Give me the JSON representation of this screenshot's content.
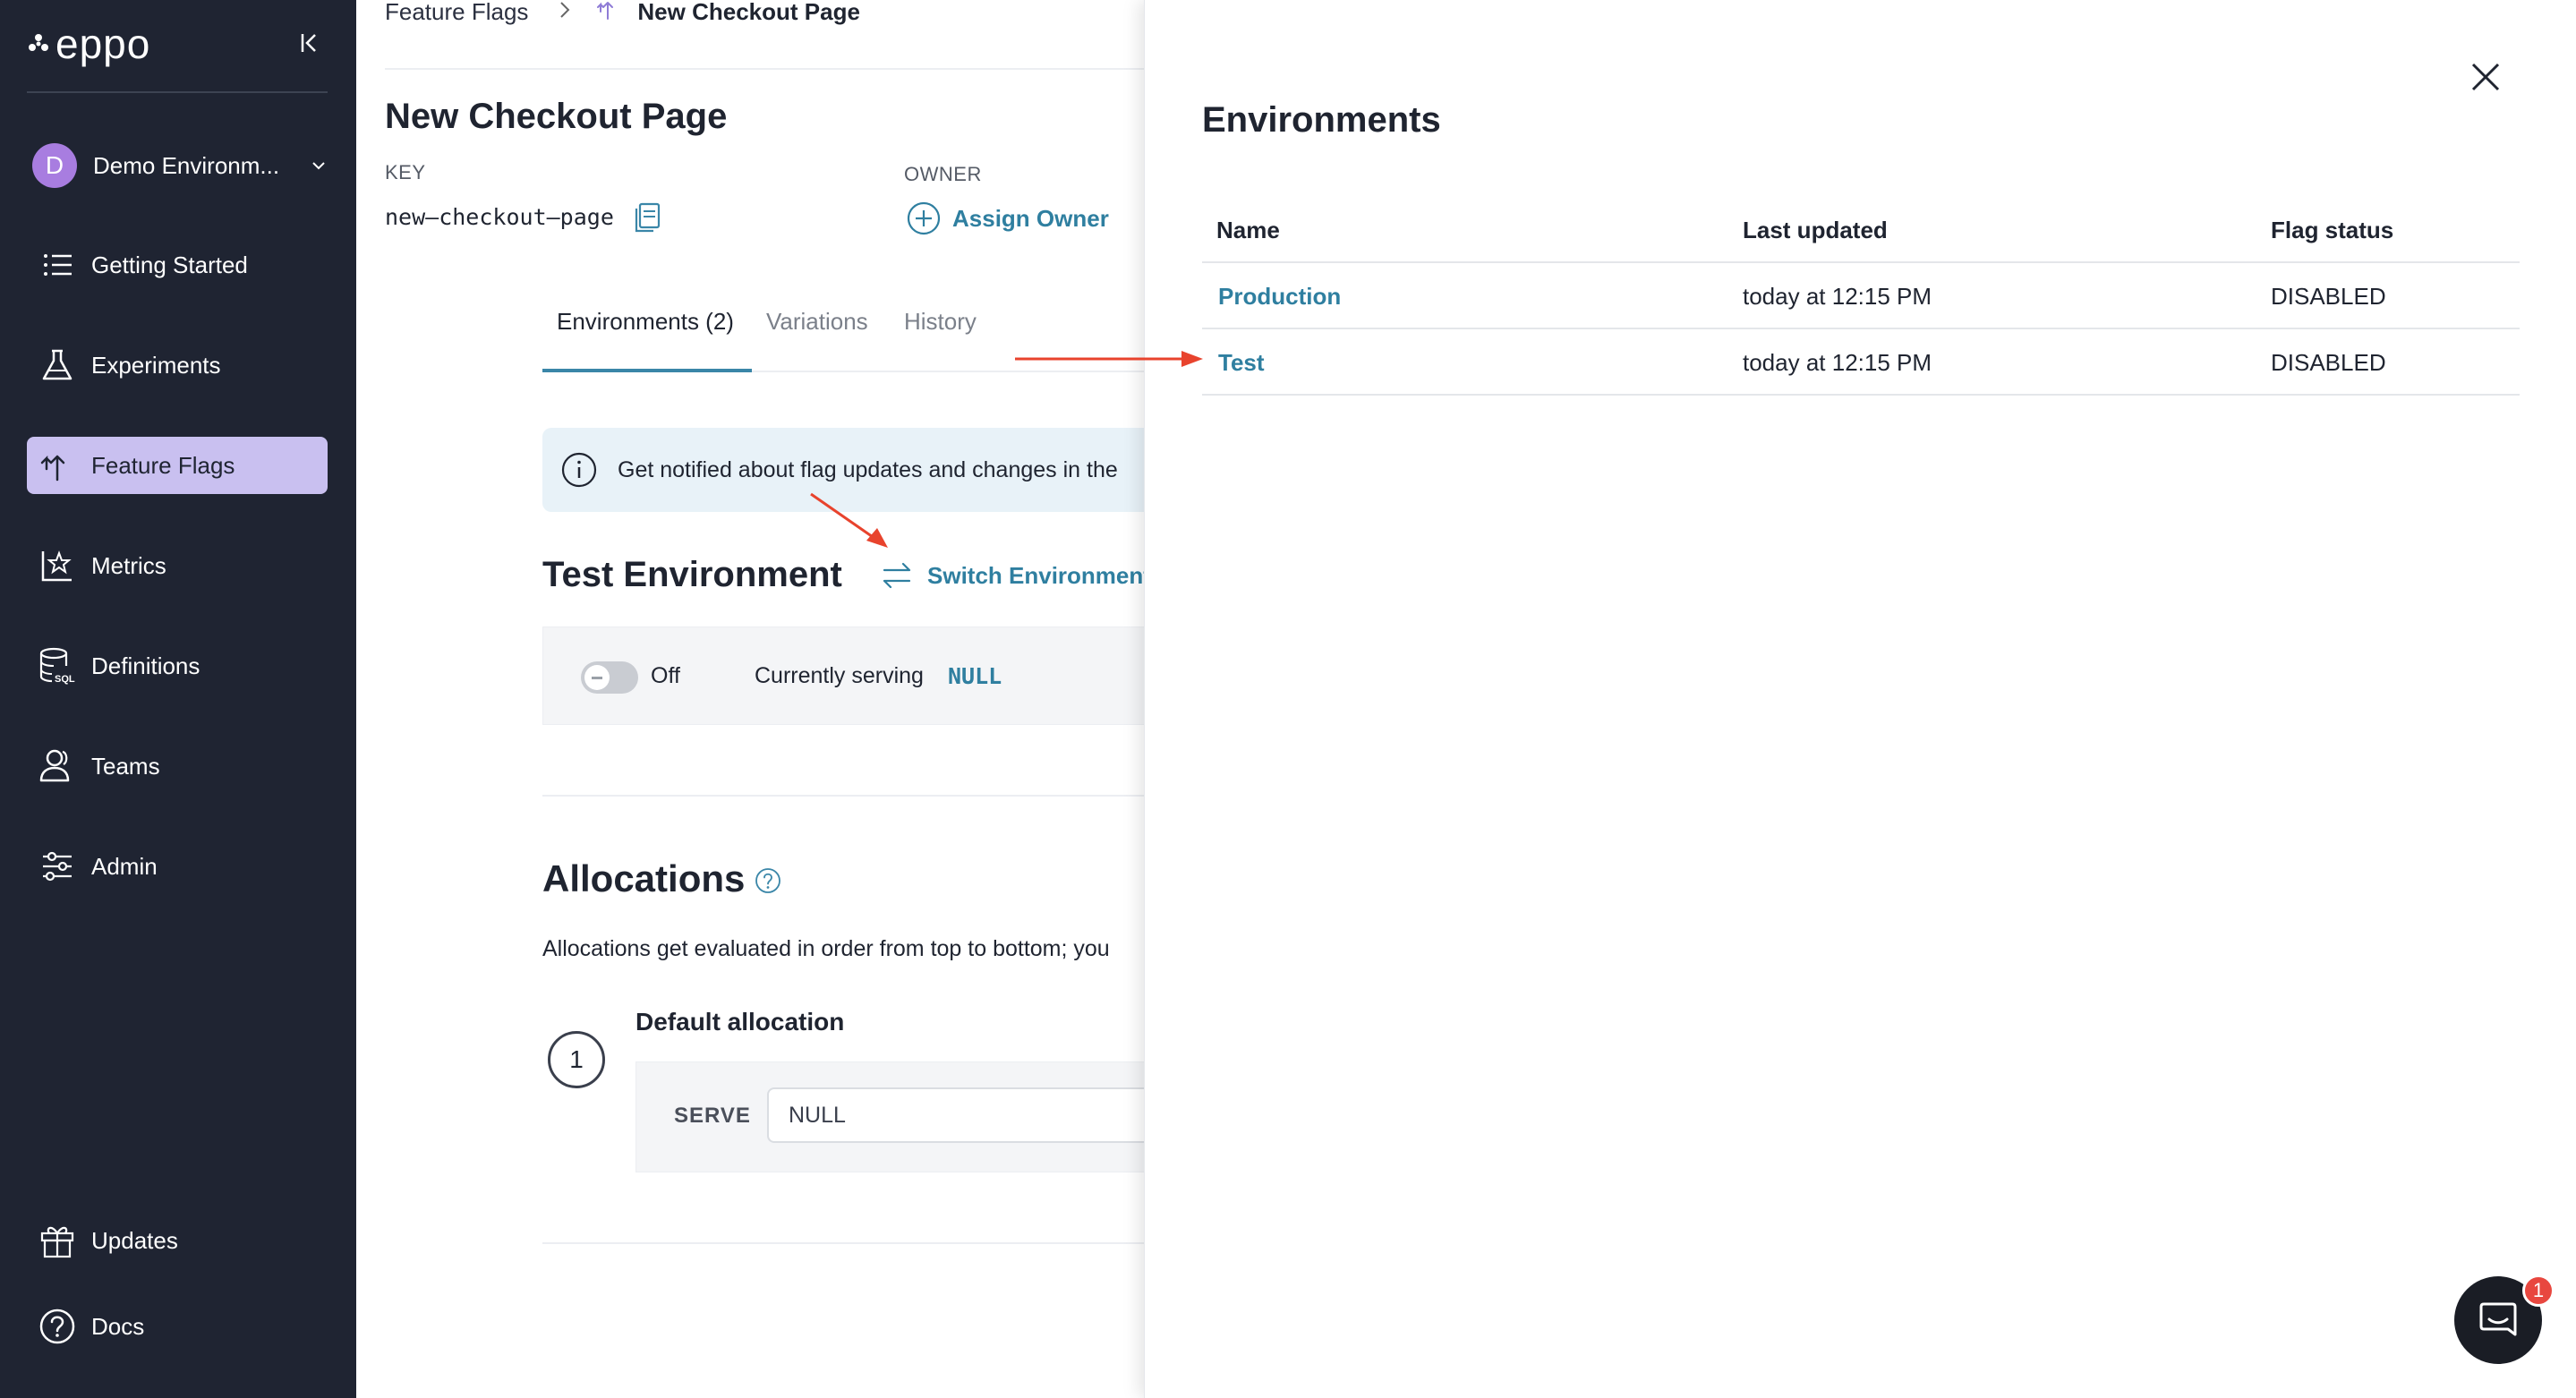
{
  "app": {
    "logo": "eppo"
  },
  "sidebar": {
    "environment": {
      "initial": "D",
      "name": "Demo Environm..."
    },
    "items": [
      {
        "label": "Getting Started",
        "icon": "list-icon"
      },
      {
        "label": "Experiments",
        "icon": "flask-icon"
      },
      {
        "label": "Feature Flags",
        "icon": "flag-branch-icon",
        "active": true
      },
      {
        "label": "Metrics",
        "icon": "chart-star-icon"
      },
      {
        "label": "Definitions",
        "icon": "database-sql-icon"
      },
      {
        "label": "Teams",
        "icon": "users-icon"
      },
      {
        "label": "Admin",
        "icon": "sliders-icon"
      }
    ],
    "footer": [
      {
        "label": "Updates",
        "icon": "gift-icon"
      },
      {
        "label": "Docs",
        "icon": "help-circle-icon"
      }
    ]
  },
  "breadcrumb": {
    "parent": "Feature Flags",
    "current": "New Checkout Page"
  },
  "flag": {
    "title": "New Checkout Page",
    "key_label": "KEY",
    "key_value": "new–checkout–page",
    "owner_label": "OWNER",
    "assign_owner": "Assign Owner"
  },
  "tabs": [
    {
      "label": "Environments (2)",
      "active": true
    },
    {
      "label": "Variations"
    },
    {
      "label": "History"
    }
  ],
  "banner": {
    "text": "Get notified about flag updates and changes in the"
  },
  "environment_section": {
    "title": "Test Environment",
    "switch_label": "Switch Environment",
    "toggle_state": "Off",
    "serving_label": "Currently serving",
    "serving_value": "NULL"
  },
  "allocations": {
    "title": "Allocations",
    "description": "Allocations get evaluated in order from top to bottom; you",
    "items": [
      {
        "number": "1",
        "name": "Default allocation",
        "serve_label": "SERVE",
        "serve_value": "NULL"
      }
    ]
  },
  "drawer": {
    "title": "Environments",
    "columns": [
      "Name",
      "Last updated",
      "Flag status"
    ],
    "rows": [
      {
        "name": "Production",
        "updated": "today at 12:15 PM",
        "status": "DISABLED"
      },
      {
        "name": "Test",
        "updated": "today at 12:15 PM",
        "status": "DISABLED"
      }
    ]
  },
  "chat": {
    "badge": "1"
  },
  "colors": {
    "sidebar_bg": "#1f2432",
    "active_nav_bg": "#c9c0f0",
    "link": "#2f7fa0",
    "annotation_arrow": "#e8432d",
    "avatar": "#a87de0"
  }
}
